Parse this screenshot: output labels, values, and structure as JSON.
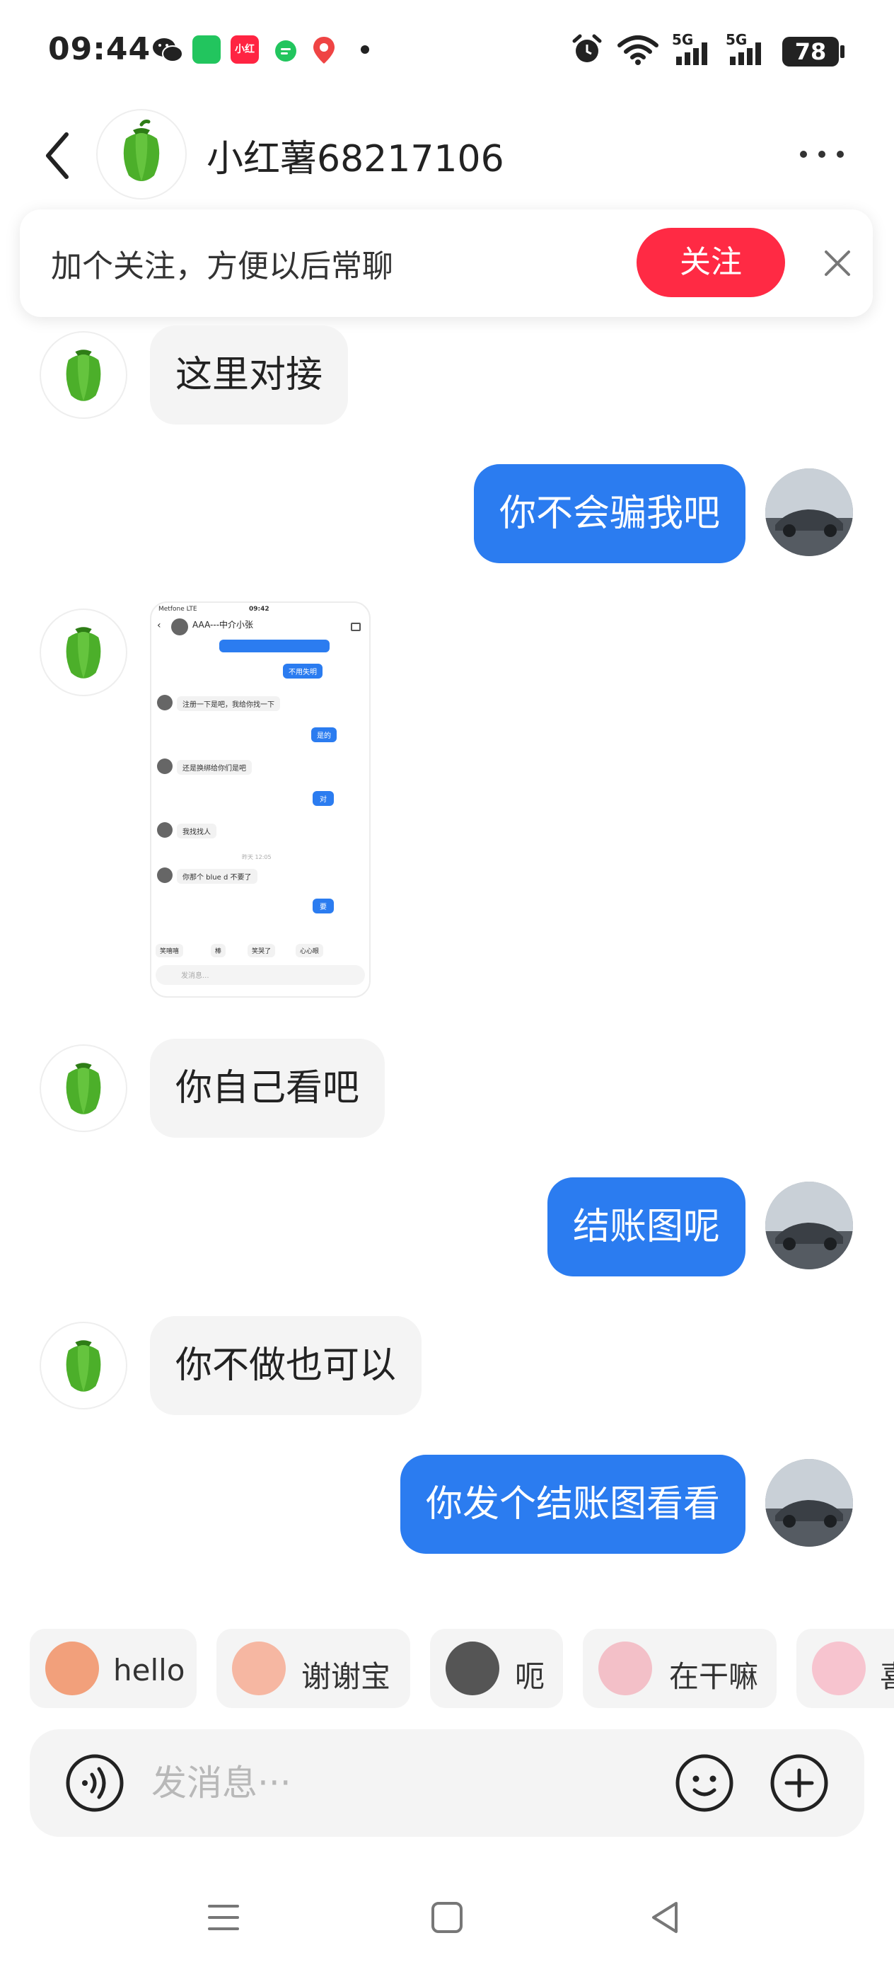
{
  "status_bar": {
    "time": "09:44",
    "app_icons": [
      {
        "name": "wechat-icon",
        "color": "#222222"
      },
      {
        "name": "shopping-bag-icon",
        "color": "#22c55e"
      },
      {
        "name": "xiaohongshu-icon",
        "color": "#ff2442",
        "label": "小红书"
      },
      {
        "name": "message-dot-icon",
        "color": "#22c55e"
      },
      {
        "name": "map-pin-icon",
        "color": "#ef4444"
      }
    ],
    "signal_1": "5G",
    "signal_2": "5G",
    "battery": "78"
  },
  "header": {
    "title": "小红薯68217106",
    "avatar_icon": "green-pepper-icon"
  },
  "follow_banner": {
    "text": "加个关注，方便以后常聊",
    "button_label": "关注"
  },
  "messages": [
    {
      "direction": "in",
      "text": "这里对接"
    },
    {
      "direction": "out",
      "text": "你不会骗我吧"
    },
    {
      "direction": "in",
      "type": "image"
    },
    {
      "direction": "in",
      "text": "你自己看吧"
    },
    {
      "direction": "out",
      "text": "结账图呢"
    },
    {
      "direction": "in",
      "text": "你不做也可以"
    },
    {
      "direction": "out",
      "text": "你发个结账图看看"
    }
  ],
  "screenshot_thumb": {
    "carrier": "Metfone  LTE",
    "time": "09:42",
    "title": "AAA---中介小张",
    "lines": [
      {
        "dir": "out",
        "text": "不用失明"
      },
      {
        "dir": "in",
        "text": "注册一下是吧，我给你找一下"
      },
      {
        "dir": "out",
        "text": "是的"
      },
      {
        "dir": "in",
        "text": "还是换绑给你们是吧"
      },
      {
        "dir": "out",
        "text": "对"
      },
      {
        "dir": "in",
        "text": "我找找人"
      },
      {
        "dir": "center",
        "text": "昨天 12:05"
      },
      {
        "dir": "in",
        "text": "你那个 blue d 不要了"
      },
      {
        "dir": "out",
        "text": "要"
      }
    ],
    "chips": [
      "笑嘻嘻",
      "棒",
      "笑哭了",
      "心心眼"
    ],
    "input_placeholder": "发消息..."
  },
  "quick_replies": [
    {
      "label": "hello",
      "icon": "monkey-emoji-icon",
      "color": "#f2a07b"
    },
    {
      "label": "谢谢宝",
      "icon": "girl-rose-emoji-icon",
      "color": "#f6b7a2"
    },
    {
      "label": "呃",
      "icon": "cat-emoji-icon",
      "color": "#555555"
    },
    {
      "label": "在干嘛",
      "icon": "magnifier-emoji-icon",
      "color": "#f3c0c8"
    },
    {
      "label": "喜",
      "icon": "pig-emoji-icon",
      "color": "#f7c4cf"
    }
  ],
  "input": {
    "placeholder": "发消息···"
  },
  "colors": {
    "accent_blue": "#2b7cf0",
    "follow_red": "#ff2a44",
    "bubble_gray": "#f4f4f4",
    "pepper_green": "#4caf2a"
  }
}
